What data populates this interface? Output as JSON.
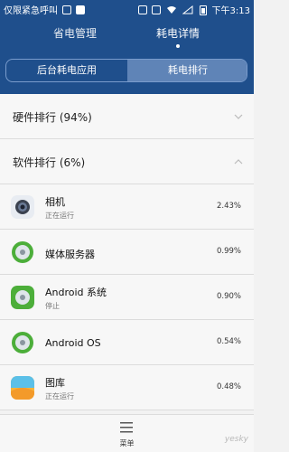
{
  "status_bar": {
    "carrier": "仅限紧急呼叫",
    "time": "下午3:13"
  },
  "header": {
    "tabs": [
      {
        "label": "省电管理"
      },
      {
        "label": "耗电详情"
      }
    ],
    "segment": [
      {
        "label": "后台耗电应用"
      },
      {
        "label": "耗电排行"
      }
    ]
  },
  "sections": {
    "hardware": {
      "label": "硬件排行 (94%)"
    },
    "software": {
      "label": "软件排行 (6%)"
    }
  },
  "apps": [
    {
      "name": "相机",
      "status": "正在运行",
      "percent": "2.43%",
      "icon": "camera-icon"
    },
    {
      "name": "媒体服务器",
      "status": "",
      "percent": "0.99%",
      "icon": "android-gear-icon"
    },
    {
      "name": "Android 系统",
      "status": "停止",
      "percent": "0.90%",
      "icon": "android-gear-icon"
    },
    {
      "name": "Android OS",
      "status": "",
      "percent": "0.54%",
      "icon": "android-gear-icon"
    },
    {
      "name": "图库",
      "status": "正在运行",
      "percent": "0.48%",
      "icon": "gallery-icon"
    }
  ],
  "bottom": {
    "menu_label": "菜单",
    "watermark": "yesky"
  },
  "colors": {
    "header": "#1f4f8c",
    "segment_active": "#5f84b7",
    "android_green": "#4cae3a"
  }
}
